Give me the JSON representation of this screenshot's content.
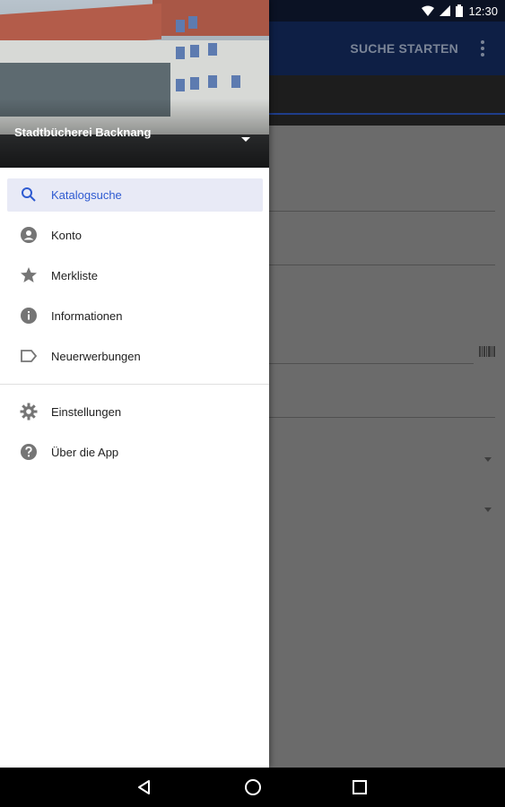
{
  "status": {
    "time": "12:30"
  },
  "appbar": {
    "action_label": "SUCHE STARTEN"
  },
  "drawer": {
    "account_name": "Stadtbücherei Backnang",
    "menu_primary": [
      {
        "label": "Katalogsuche",
        "icon": "search-icon",
        "active": true
      },
      {
        "label": "Konto",
        "icon": "account-circle-icon",
        "active": false
      },
      {
        "label": "Merkliste",
        "icon": "star-icon",
        "active": false
      },
      {
        "label": "Informationen",
        "icon": "info-icon",
        "active": false
      },
      {
        "label": "Neuerwerbungen",
        "icon": "label-tag-icon",
        "active": false
      }
    ],
    "menu_secondary": [
      {
        "label": "Einstellungen",
        "icon": "gear-icon"
      },
      {
        "label": "Über die App",
        "icon": "help-icon"
      }
    ]
  },
  "colors": {
    "accent": "#2f5bd1",
    "appbar": "#0e1f45",
    "active_bg": "#e8eaf6"
  }
}
